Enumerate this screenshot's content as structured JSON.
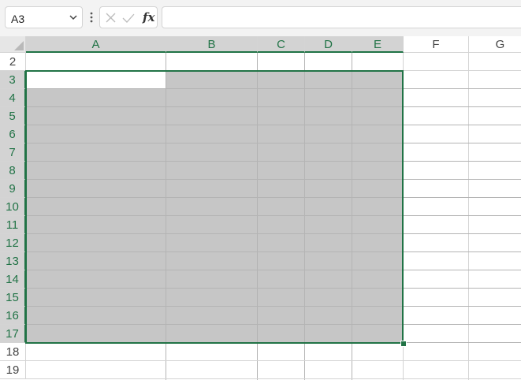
{
  "name_box": {
    "value": "A3"
  },
  "formula_bar": {
    "cancel_icon": "close-x-icon",
    "enter_icon": "checkmark-icon",
    "fx_label": "fx",
    "formula_value": ""
  },
  "columns": [
    {
      "label": "A",
      "selected": true
    },
    {
      "label": "B",
      "selected": true
    },
    {
      "label": "C",
      "selected": true
    },
    {
      "label": "D",
      "selected": true
    },
    {
      "label": "E",
      "selected": true
    },
    {
      "label": "F",
      "selected": false
    },
    {
      "label": "G",
      "selected": false
    }
  ],
  "rows": [
    {
      "label": "2",
      "selected": false
    },
    {
      "label": "3",
      "selected": true
    },
    {
      "label": "4",
      "selected": true
    },
    {
      "label": "5",
      "selected": true
    },
    {
      "label": "6",
      "selected": true
    },
    {
      "label": "7",
      "selected": true
    },
    {
      "label": "8",
      "selected": true
    },
    {
      "label": "9",
      "selected": true
    },
    {
      "label": "10",
      "selected": true
    },
    {
      "label": "11",
      "selected": true
    },
    {
      "label": "12",
      "selected": true
    },
    {
      "label": "13",
      "selected": true
    },
    {
      "label": "14",
      "selected": true
    },
    {
      "label": "15",
      "selected": true
    },
    {
      "label": "16",
      "selected": true
    },
    {
      "label": "17",
      "selected": true
    },
    {
      "label": "18",
      "selected": false
    },
    {
      "label": "19",
      "selected": false
    }
  ],
  "selection": {
    "range": "A3:E17",
    "active_cell": "A3"
  },
  "colors": {
    "accent": "#217346",
    "selection_fill": "#c6c6c6",
    "header_selected_bg": "#d3d3d3",
    "gridline": "#d4d4d4"
  }
}
